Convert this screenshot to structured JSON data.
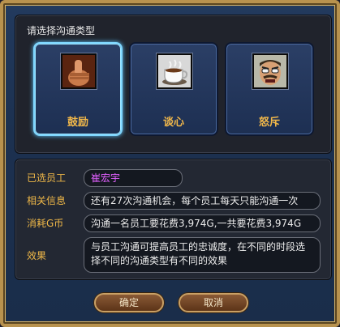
{
  "dialog": {
    "prompt": "请选择沟通类型",
    "options": [
      {
        "label": "鼓励",
        "icon": "thumbs-up-icon",
        "selected": true
      },
      {
        "label": "谈心",
        "icon": "coffee-cup-icon",
        "selected": false
      },
      {
        "label": "怒斥",
        "icon": "angry-boss-icon",
        "selected": false
      }
    ],
    "info": {
      "employee_label": "已选员工",
      "employee_value": "崔宏宇",
      "related_label": "相关信息",
      "related_value": "还有27次沟通机会，每个员工每天只能沟通一次",
      "cost_label": "消耗G币",
      "cost_value": "沟通一名员工要花费3,974G,一共要花费3,974G",
      "effect_label": "效果",
      "effect_value": "与员工沟通可提高员工的忠诚度，在不同的时段选择不同的沟通类型有不同的效果"
    },
    "buttons": {
      "confirm": "确定",
      "cancel": "取消"
    },
    "colors": {
      "accent_label": "#f0b848",
      "selected_glow": "#7fd7ff",
      "employee_name": "#e160ff"
    }
  }
}
